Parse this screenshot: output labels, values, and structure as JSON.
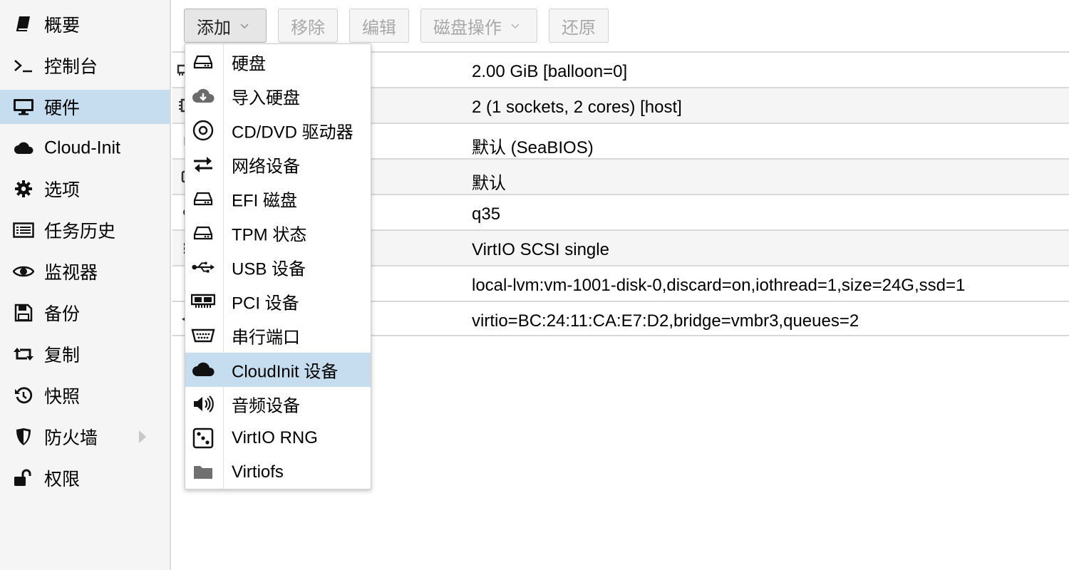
{
  "sidebar": {
    "items": [
      {
        "label": "概要",
        "icon": "book-icon"
      },
      {
        "label": "控制台",
        "icon": "terminal-icon"
      },
      {
        "label": "硬件",
        "icon": "desktop-icon",
        "selected": true
      },
      {
        "label": "Cloud-Init",
        "icon": "cloud-icon"
      },
      {
        "label": "选项",
        "icon": "gear-icon"
      },
      {
        "label": "任务历史",
        "icon": "list-icon"
      },
      {
        "label": "监视器",
        "icon": "eye-icon"
      },
      {
        "label": "备份",
        "icon": "floppy-icon"
      },
      {
        "label": "复制",
        "icon": "retweet-icon"
      },
      {
        "label": "快照",
        "icon": "history-icon"
      },
      {
        "label": "防火墙",
        "icon": "shield-icon",
        "has_submenu": true
      },
      {
        "label": "权限",
        "icon": "unlock-icon"
      }
    ]
  },
  "toolbar": {
    "add_label": "添加",
    "remove_label": "移除",
    "edit_label": "编辑",
    "disk_action_label": "磁盘操作",
    "revert_label": "还原"
  },
  "hardware_rows": [
    {
      "value": "2.00 GiB [balloon=0]"
    },
    {
      "value": "2 (1 sockets, 2 cores) [host]"
    },
    {
      "value": "默认 (SeaBIOS)"
    },
    {
      "value": "默认"
    },
    {
      "value": "q35"
    },
    {
      "value": "VirtIO SCSI single"
    },
    {
      "value": "local-lvm:vm-1001-disk-0,discard=on,iothread=1,size=24G,ssd=1"
    },
    {
      "value": "virtio=BC:24:11:CA:E7:D2,bridge=vmbr3,queues=2"
    }
  ],
  "add_menu": {
    "items": [
      {
        "label": "硬盘",
        "icon": "hdd-icon"
      },
      {
        "label": "导入硬盘",
        "icon": "cloud-download-icon"
      },
      {
        "label": "CD/DVD 驱动器",
        "icon": "disc-icon"
      },
      {
        "label": "网络设备",
        "icon": "exchange-icon"
      },
      {
        "label": "EFI 磁盘",
        "icon": "hdd-icon"
      },
      {
        "label": "TPM 状态",
        "icon": "hdd-icon"
      },
      {
        "label": "USB 设备",
        "icon": "usb-icon"
      },
      {
        "label": "PCI 设备",
        "icon": "pci-card-icon"
      },
      {
        "label": "串行端口",
        "icon": "serial-port-icon"
      },
      {
        "label": "CloudInit 设备",
        "icon": "cloud-icon",
        "highlighted": true
      },
      {
        "label": "音频设备",
        "icon": "volume-icon"
      },
      {
        "label": "VirtIO RNG",
        "icon": "dice-icon"
      },
      {
        "label": "Virtiofs",
        "icon": "folder-icon"
      }
    ]
  },
  "colors": {
    "selected_bg": "#c6ddf0",
    "sidebar_bg": "#f5f5f5",
    "row_alt_bg": "#f5f5f5"
  }
}
